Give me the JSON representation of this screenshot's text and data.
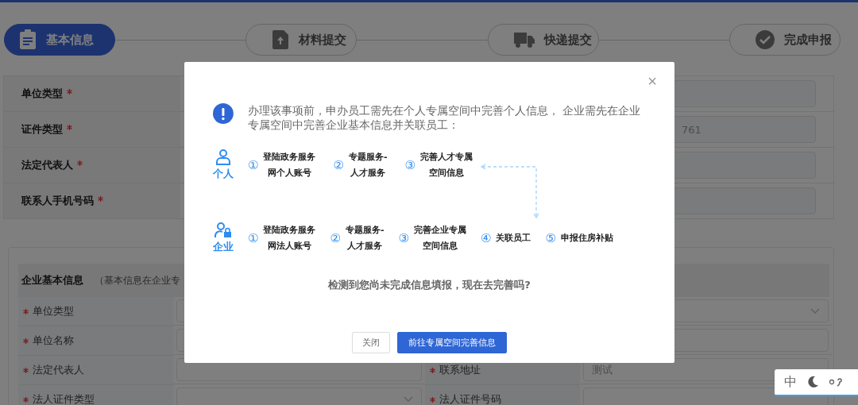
{
  "steps": [
    {
      "label": "基本信息",
      "selected": true
    },
    {
      "label": "材料提交",
      "selected": false
    },
    {
      "label": "快递提交",
      "selected": false
    },
    {
      "label": "完成申报",
      "selected": false
    }
  ],
  "top_form": {
    "rows": [
      {
        "label": "单位类型",
        "required": true
      },
      {
        "label": "证件类型",
        "required": true,
        "value": "761"
      },
      {
        "label": "法定代表人",
        "required": true
      },
      {
        "label": "联系人手机号码",
        "required": true
      }
    ]
  },
  "company_section": {
    "title": "企业基本信息",
    "note": "（基本信息在企业专",
    "left_rows": [
      {
        "label": "单位类型",
        "required": true,
        "kind": "text"
      },
      {
        "label": "单位名称",
        "required": true,
        "kind": "text"
      },
      {
        "label": "法定代表人",
        "required": true,
        "kind": "text"
      },
      {
        "label": "法人证件类型",
        "required": true,
        "kind": "select"
      }
    ],
    "right_rows": [
      {
        "kind": "select"
      },
      {
        "kind": "text"
      },
      {
        "label": "联系地址",
        "required": true,
        "kind": "text",
        "value": "测试"
      },
      {
        "label": "法人证件号码",
        "required": true,
        "kind": "text"
      }
    ]
  },
  "dialog": {
    "close": "×",
    "message": "办理该事项前，申办员工需先在个人专属空间中完善个人信息， 企业需先在企业专属空间中完善企业基本信息并关联员工：",
    "flows": [
      {
        "name": "个人",
        "steps": [
          {
            "number": "①",
            "lines": [
              "登陆政务服务",
              "网个人账号"
            ]
          },
          {
            "number": "②",
            "lines": [
              "专题服务-",
              "人才服务"
            ]
          },
          {
            "number": "③",
            "lines": [
              "完善人才专属",
              "空间信息"
            ]
          }
        ]
      },
      {
        "name": "企业",
        "steps": [
          {
            "number": "①",
            "lines": [
              "登陆政务服务",
              "网法人账号"
            ]
          },
          {
            "number": "②",
            "lines": [
              "专题服务-",
              "人才服务"
            ]
          },
          {
            "number": "③",
            "lines": [
              "完善企业专属",
              "空间信息"
            ]
          },
          {
            "number": "④",
            "lines": [
              "关联员工"
            ]
          },
          {
            "number": "⑤",
            "lines": [
              "申报住房补贴"
            ]
          }
        ]
      }
    ],
    "question": "检测到您尚未完成信息填报，现在去完善吗?",
    "buttons": [
      {
        "label": "关闭",
        "kind": "default"
      },
      {
        "label": "前往专属空间完善信息",
        "kind": "primary"
      }
    ]
  },
  "ime": {
    "mode": "中"
  }
}
